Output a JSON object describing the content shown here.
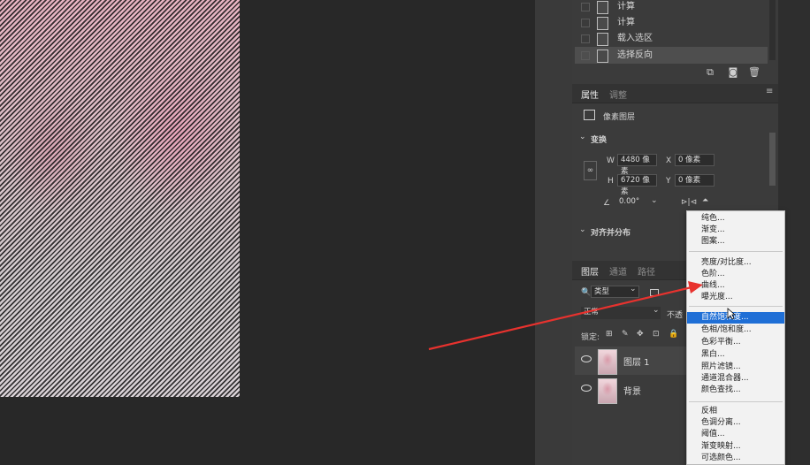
{
  "history": {
    "items": [
      {
        "label": "计算",
        "selected": false
      },
      {
        "label": "计算",
        "selected": false
      },
      {
        "label": "载入选区",
        "selected": false
      },
      {
        "label": "选择反向",
        "selected": true
      }
    ]
  },
  "properties": {
    "tab_active": "属性",
    "tab_inactive": "调整",
    "layer_type": "像素图层",
    "transform_title": "变换",
    "w_label": "W",
    "w_value": "4480 像素",
    "x_label": "X",
    "x_value": "0 像素",
    "h_label": "H",
    "h_value": "6720 像素",
    "y_label": "Y",
    "y_value": "0 像素",
    "angle_value": "0.00°",
    "align_title": "对齐并分布"
  },
  "layers_panel": {
    "tabs": [
      "图层",
      "通道",
      "路径"
    ],
    "filter_label": "类型",
    "blend_mode": "正常",
    "opacity_label": "不透",
    "lock_label": "锁定:",
    "layers": [
      {
        "name": "图层 1",
        "selected": true
      },
      {
        "name": "背景",
        "selected": false
      }
    ]
  },
  "menu": {
    "groups": [
      [
        "纯色...",
        "渐变...",
        "图案..."
      ],
      [
        "亮度/对比度...",
        "色阶...",
        "曲线...",
        "曝光度..."
      ],
      [
        "自然饱和度...",
        "色相/饱和度...",
        "色彩平衡...",
        "黑白...",
        "照片滤镜...",
        "通道混合器...",
        "颜色查找..."
      ],
      [
        "反相",
        "色调分离...",
        "阈值...",
        "渐变映射...",
        "可选颜色..."
      ]
    ],
    "highlighted": "自然饱和度..."
  },
  "colors": {
    "menu_highlight": "#1f6fd6",
    "arrow": "#e8322e",
    "panel_bg": "#3b3b3b"
  }
}
